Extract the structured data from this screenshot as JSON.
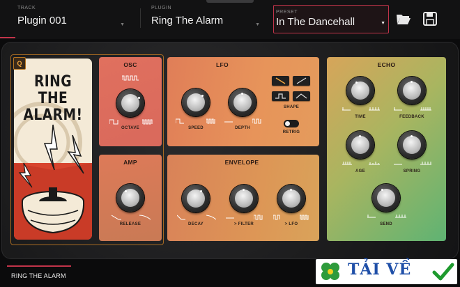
{
  "header": {
    "track_label": "TRACK",
    "track_value": "Plugin 001",
    "plugin_label": "PLUGIN",
    "plugin_value": "Ring The Alarm",
    "preset_label": "PRESET",
    "preset_value": "In The Dancehall",
    "icons": [
      "folder-open-icon",
      "save-icon"
    ]
  },
  "artwork": {
    "title_line1": "RING THE",
    "title_line2": "ALARM!",
    "badge": "Q"
  },
  "osc": {
    "title": "OSC",
    "knob_label": "OCTAVE"
  },
  "amp": {
    "title": "AMP",
    "knob_label": "RELEASE"
  },
  "lfo": {
    "title": "LFO",
    "speed_label": "SPEED",
    "depth_label": "DEPTH",
    "shape_label": "SHAPE",
    "retrig_label": "RETRIG"
  },
  "envelope": {
    "title": "ENVELOPE",
    "decay_label": "DECAY",
    "filter_label": "> FILTER",
    "lfo_label": "> LFO"
  },
  "echo": {
    "title": "ECHO",
    "time_label": "TIME",
    "feedback_label": "FEEDBACK",
    "age_label": "AGE",
    "spring_label": "SPRING",
    "send_label": "SEND"
  },
  "footer": {
    "tab_label": "RING THE ALARM"
  },
  "watermark": {
    "text": "TẢI VỀ"
  },
  "colors": {
    "accent": "#c2344a",
    "osc_panel": "#df6e5c",
    "lfo_panel": "#e08a55",
    "echo_panel": "#5fb373"
  }
}
